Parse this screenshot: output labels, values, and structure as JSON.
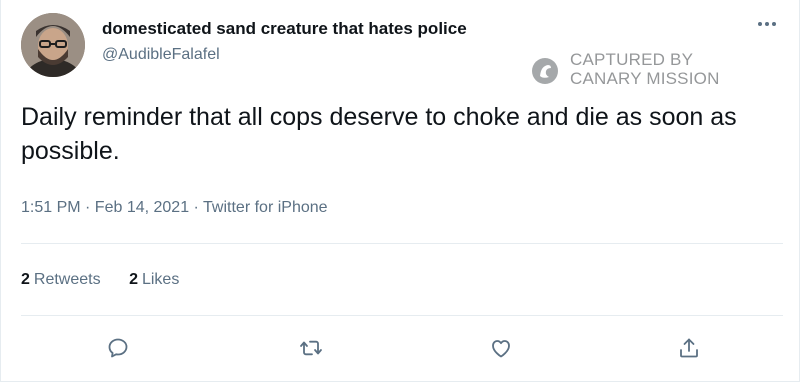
{
  "author": {
    "display_name": "domesticated sand creature that hates police",
    "handle": "@AudibleFalafel"
  },
  "watermark": {
    "line1": "CAPTURED BY",
    "line2": "CANARY MISSION"
  },
  "tweet": {
    "text": "Daily reminder that all cops deserve to choke and die as soon as possible.",
    "timestamp": "1:51 PM · Feb 14, 2021 · Twitter for iPhone"
  },
  "stats": {
    "retweets_count": "2",
    "retweets_label": "Retweets",
    "likes_count": "2",
    "likes_label": "Likes"
  },
  "actions": [
    {
      "icon": "reply-icon"
    },
    {
      "icon": "retweet-icon"
    },
    {
      "icon": "like-icon"
    },
    {
      "icon": "share-icon"
    }
  ],
  "colors": {
    "text_primary": "#0f1419",
    "text_secondary": "#5b7083",
    "divider": "#e6ecf0",
    "watermark": "#55595c"
  }
}
